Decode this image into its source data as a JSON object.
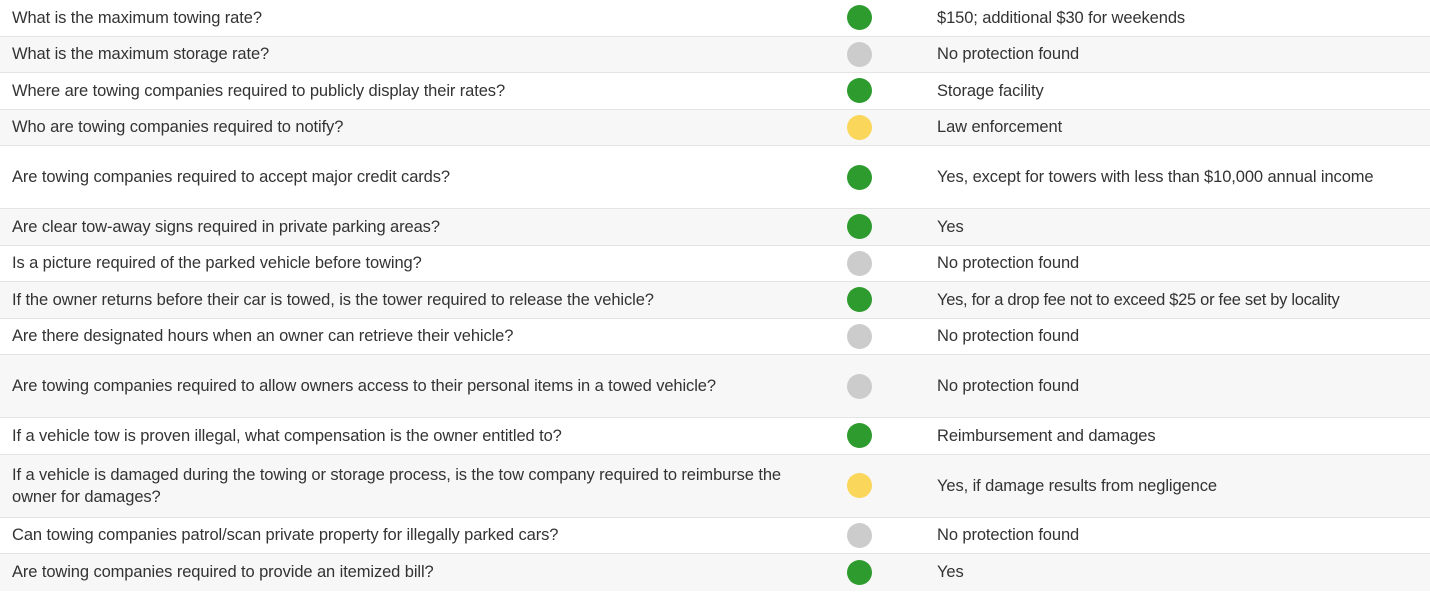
{
  "colors": {
    "green": "#2e9b2e",
    "gray": "#cccccc",
    "yellow": "#fad65a"
  },
  "rows": [
    {
      "question": "What is the maximum towing rate?",
      "status": "green",
      "answer": "$150; additional $30 for weekends"
    },
    {
      "question": "What is the maximum storage rate?",
      "status": "gray",
      "answer": "No protection found"
    },
    {
      "question": "Where are towing companies required to publicly display their rates?",
      "status": "green",
      "answer": "Storage facility"
    },
    {
      "question": "Who are towing companies required to notify?",
      "status": "yellow",
      "answer": "Law enforcement"
    },
    {
      "question": "Are towing companies required to accept major credit cards?",
      "status": "green",
      "answer": "Yes, except for towers with less than $10,000 annual income"
    },
    {
      "question": "Are clear tow-away signs required in private parking areas?",
      "status": "green",
      "answer": "Yes"
    },
    {
      "question": "Is a picture required of the parked vehicle before towing?",
      "status": "gray",
      "answer": "No protection found"
    },
    {
      "question": "If the owner returns before their car is towed, is the tower required to release the vehicle?",
      "status": "green",
      "answer": "Yes, for a drop fee not to exceed $25 or fee set by locality"
    },
    {
      "question": "Are there designated hours when an owner can retrieve their vehicle?",
      "status": "gray",
      "answer": "No protection found"
    },
    {
      "question": "Are towing companies required to allow owners access to their personal items in a towed vehicle?",
      "status": "gray",
      "answer": "No protection found"
    },
    {
      "question": "If a vehicle tow is proven illegal, what compensation is the owner entitled to?",
      "status": "green",
      "answer": "Reimbursement and damages"
    },
    {
      "question": "If a vehicle is damaged during the towing or storage process, is the tow company required to reimburse the owner for damages?",
      "status": "yellow",
      "answer": "Yes, if damage results from negligence"
    },
    {
      "question": "Can towing companies patrol/scan private property for illegally parked cars?",
      "status": "gray",
      "answer": "No protection found"
    },
    {
      "question": "Are towing companies required to provide an itemized bill?",
      "status": "green",
      "answer": "Yes"
    }
  ]
}
